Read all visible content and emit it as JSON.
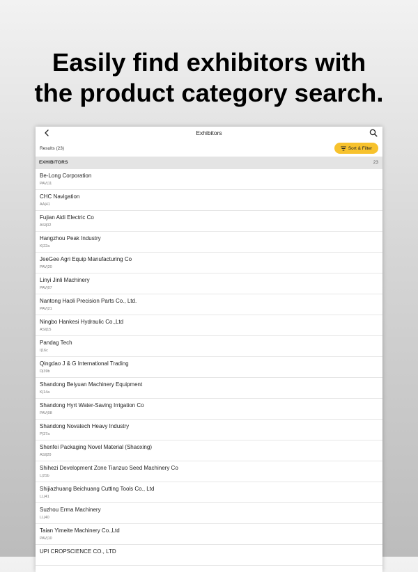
{
  "headline": {
    "line1": "Easily find exhibitors with",
    "line2": "the product category search."
  },
  "navbar": {
    "title": "Exhibitors",
    "back_icon": "chevron-left-icon",
    "search_icon": "search-icon"
  },
  "results": {
    "label": "Results (23)",
    "sort_filter_label": "Sort & Filter",
    "sort_filter_color": "#f7c22d"
  },
  "section": {
    "title": "EXHIBITORS",
    "count": "23"
  },
  "exhibitors": [
    {
      "name": "Be-Long Corporation",
      "booth": "PAV|11"
    },
    {
      "name": "CHC Navigation",
      "booth": "AA|41"
    },
    {
      "name": "Fujian Aidi Electric Co",
      "booth": "ASI|02"
    },
    {
      "name": "Hangzhou Peak Industry",
      "booth": "K|22a"
    },
    {
      "name": "JeeGee Agri Equip Manufacturing Co",
      "booth": "PAV|20"
    },
    {
      "name": "Linyi Jinli Machinery",
      "booth": "PAV|07"
    },
    {
      "name": "Nantong Haoli Precision Parts Co., Ltd.",
      "booth": "PAV|21"
    },
    {
      "name": "Ningbo Hankesi Hydraulic Co.,Ltd",
      "booth": "ASI|15"
    },
    {
      "name": "Pandag Tech",
      "booth": "I|16c"
    },
    {
      "name": "Qingdao J & G International Trading",
      "booth": "D|39b"
    },
    {
      "name": "Shandong Beiyuan Machinery Equipment",
      "booth": "K|14a"
    },
    {
      "name": "Shandong Hyrt Water-Saving Irrigation Co",
      "booth": "PAV|08"
    },
    {
      "name": "Shandong Novatech Heavy Industry",
      "booth": "P|37a"
    },
    {
      "name": "Shenfei Packaging Novel Material (Shaoxing)",
      "booth": "ASI|20"
    },
    {
      "name": "Shihezi Development Zone Tianzuo Seed Machinery Co",
      "booth": "L|21b"
    },
    {
      "name": "Shijiazhuang Beichuang Cutting Tools Co., Ltd",
      "booth": "LL|41"
    },
    {
      "name": "Suzhou Erma Machinery",
      "booth": "LL|40"
    },
    {
      "name": "Taian Yimeite Machinery Co.,Ltd",
      "booth": "PAV|10"
    },
    {
      "name": "UPI CROPSCIENCE CO., LTD",
      "booth": ""
    }
  ]
}
